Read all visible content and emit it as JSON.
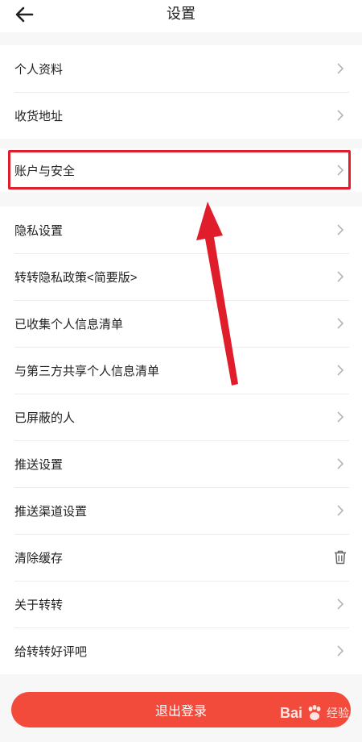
{
  "header": {
    "title": "设置"
  },
  "section1": {
    "items": [
      {
        "label": "个人资料"
      },
      {
        "label": "收货地址"
      }
    ]
  },
  "section2": {
    "items": [
      {
        "label": "账户与安全"
      }
    ]
  },
  "section3": {
    "items": [
      {
        "label": "隐私设置"
      },
      {
        "label": "转转隐私政策<简要版>"
      },
      {
        "label": "已收集个人信息清单"
      },
      {
        "label": "与第三方共享个人信息清单"
      },
      {
        "label": "已屏蔽的人"
      },
      {
        "label": "推送设置"
      },
      {
        "label": "推送渠道设置"
      },
      {
        "label": "清除缓存"
      },
      {
        "label": "关于转转"
      },
      {
        "label": "给转转好评吧"
      }
    ]
  },
  "footer": {
    "logout_label": "退出登录"
  },
  "watermark": {
    "brand": "Bai",
    "brand_suffix": "经验"
  },
  "colors": {
    "accent_red": "#f24a3b",
    "annotation_red": "#e01d2b",
    "chevron": "#b5b5b5"
  },
  "icons": {
    "back": "arrow-left-icon",
    "row": "chevron-right-icon",
    "clear_cache": "trash-icon"
  }
}
